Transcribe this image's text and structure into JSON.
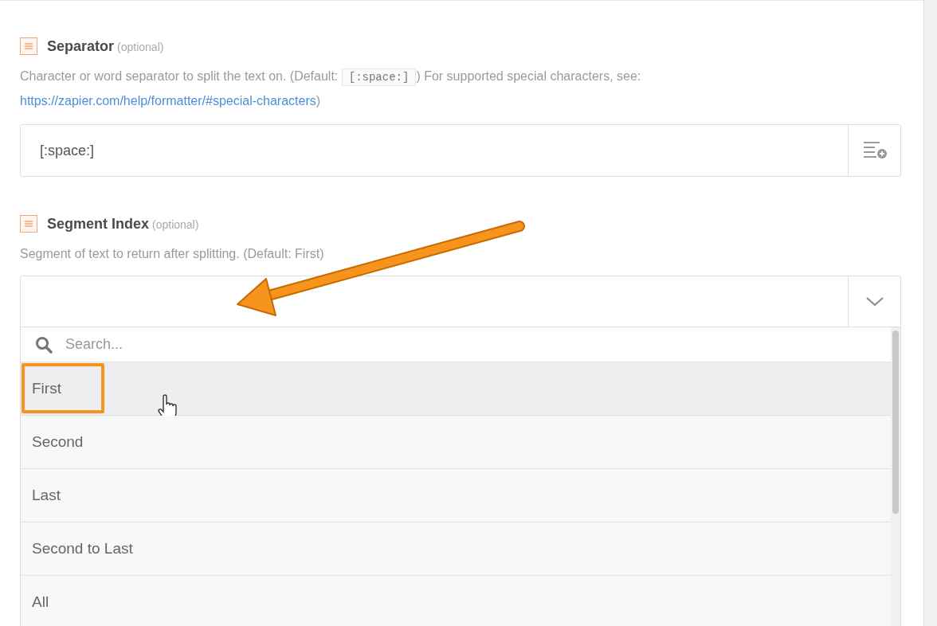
{
  "fields": [
    {
      "kind": "text",
      "label": "Separator",
      "hint": "(optional)",
      "description": {
        "before": "Character or word separator to split the text on. (Default: ",
        "code": "[:space:]",
        "middle": ") For supported special characters, see: ",
        "link": "https://zapier.com/help/formatter/#special-characters",
        "after": ")"
      },
      "value": "[:space:]"
    },
    {
      "kind": "select",
      "label": "Segment Index",
      "hint": "(optional)",
      "description": {
        "before": "Segment of text to return after splitting. (Default: First)"
      },
      "expanded": true,
      "search": {
        "placeholder": "Search..."
      },
      "options": [
        {
          "label": "First",
          "selected": true
        },
        {
          "label": "Second",
          "selected": false
        },
        {
          "label": "Last",
          "selected": false
        },
        {
          "label": "Second to Last",
          "selected": false
        },
        {
          "label": "All",
          "selected": false
        }
      ]
    }
  ]
}
